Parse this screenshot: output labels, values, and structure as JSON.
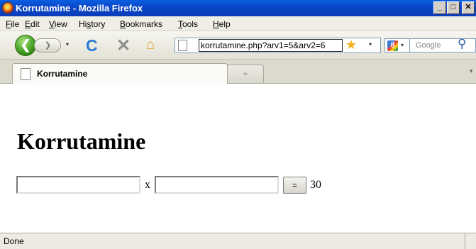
{
  "window": {
    "title": "Korrutamine - Mozilla Firefox",
    "controls": {
      "minimize": "_",
      "maximize": "□",
      "close": "✕"
    }
  },
  "menubar": {
    "items": [
      {
        "label": "File",
        "accel": "F"
      },
      {
        "label": "Edit",
        "accel": "E"
      },
      {
        "label": "View",
        "accel": "V"
      },
      {
        "label": "History",
        "accel": "s"
      },
      {
        "label": "Bookmarks",
        "accel": "B"
      },
      {
        "label": "Tools",
        "accel": "T"
      },
      {
        "label": "Help",
        "accel": "H"
      }
    ]
  },
  "navbar": {
    "back_glyph": "❮",
    "forward_glyph": "❯",
    "dropdown_glyph": "▾",
    "reload_glyph": "C",
    "stop_glyph": "✕",
    "home_glyph": "⌂",
    "url": "korrutamine.php?arv1=5&arv2=6",
    "star_glyph": "★",
    "search_engine_glyph": "8",
    "search_placeholder": "Google",
    "search_glyph": "⚲"
  },
  "tabs": {
    "active_label": "Korrutamine",
    "new_tab_glyph": "+",
    "list_glyph": "▾"
  },
  "page": {
    "heading": "Korrutamine",
    "operator": "x",
    "equals_label": "=",
    "result": "30",
    "field_a_value": "",
    "field_b_value": ""
  },
  "statusbar": {
    "text": "Done"
  },
  "colors": {
    "titlebar": "#0a46c8",
    "chrome": "#ece9d8",
    "back_button": "#3d9a1e",
    "reload": "#2a7ad1",
    "star": "#f1b01c"
  }
}
